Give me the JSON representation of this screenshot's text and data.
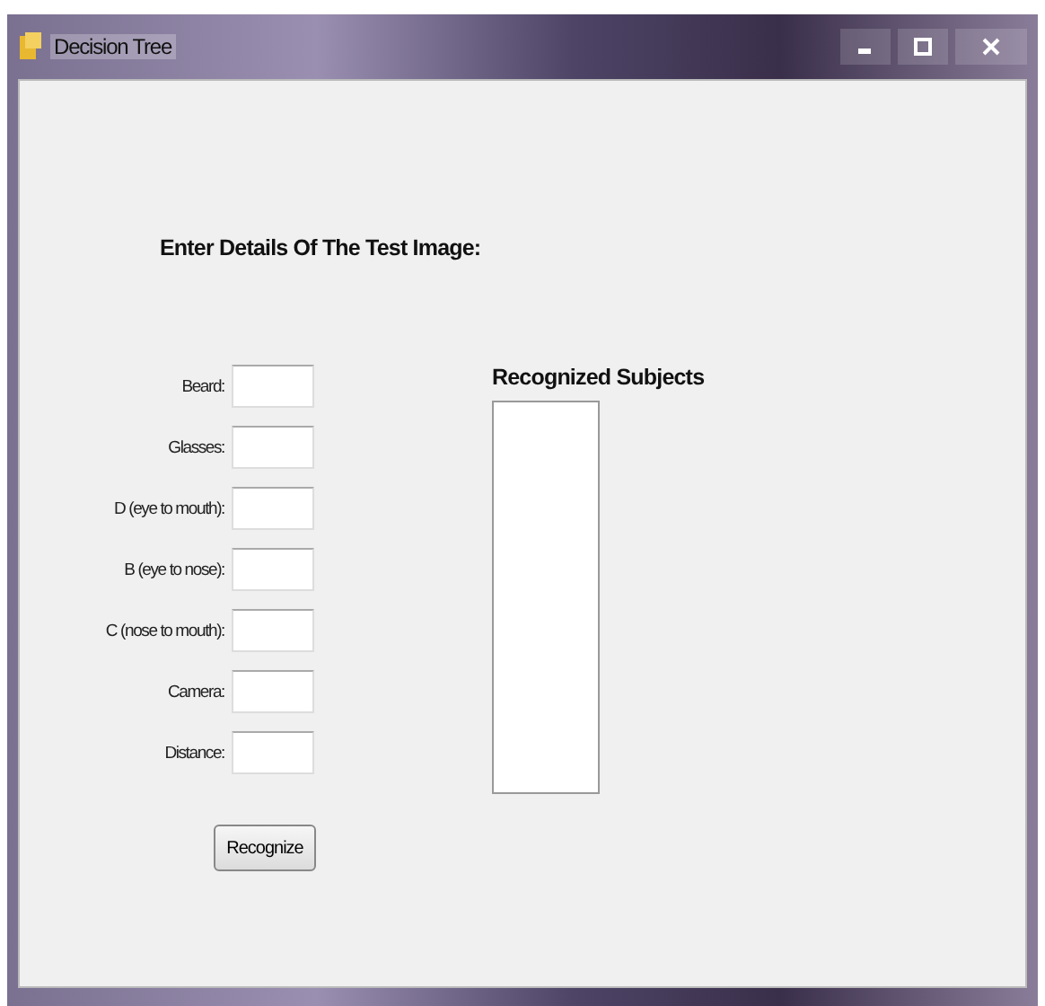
{
  "window": {
    "title": "Decision Tree"
  },
  "heading": "Enter Details Of The Test Image:",
  "fields": [
    {
      "label": "Beard:"
    },
    {
      "label": "Glasses:"
    },
    {
      "label": "D (eye to mouth):"
    },
    {
      "label": "B (eye to nose):"
    },
    {
      "label": "C (nose to mouth):"
    },
    {
      "label": "Camera:"
    },
    {
      "label": "Distance:"
    }
  ],
  "recognized": {
    "title": "Recognized Subjects"
  },
  "buttons": [
    "Recognize"
  ]
}
